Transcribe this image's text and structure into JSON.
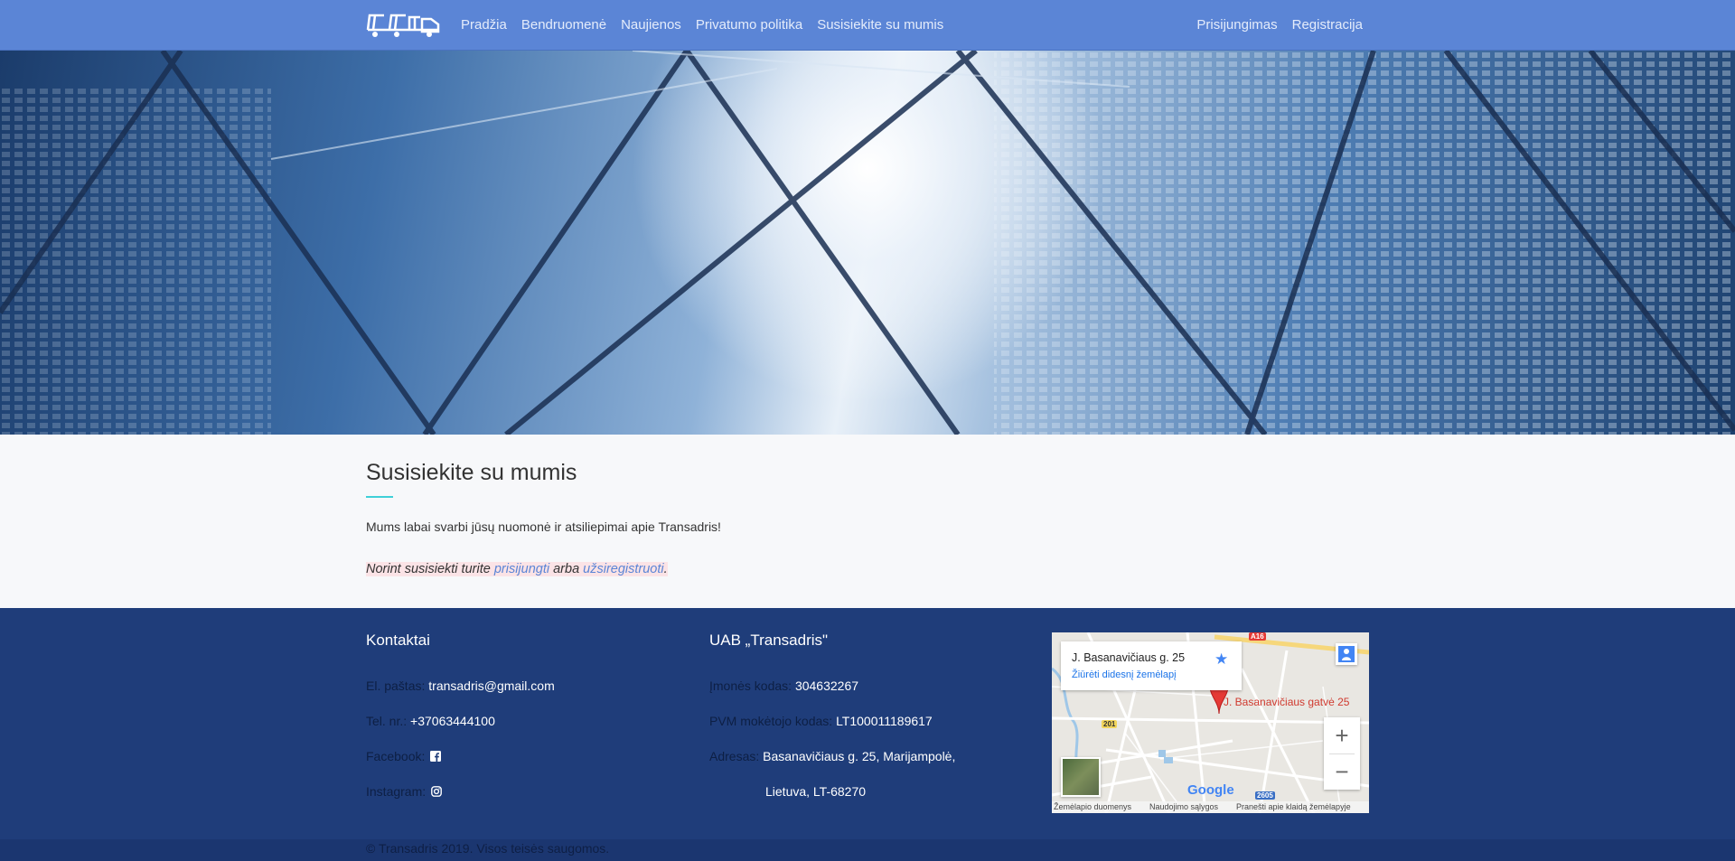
{
  "nav": {
    "logo_alt": "Transadris logo",
    "links": [
      "Pradžia",
      "Bendruomenė",
      "Naujienos",
      "Privatumo politika",
      "Susisiekite su mumis"
    ],
    "right_links": [
      "Prisijungimas",
      "Registracija"
    ]
  },
  "content": {
    "title": "Susisiekite su mumis",
    "intro": "Mums labai svarbi jūsų nuomonė ir atsiliepimai apie Transadris!",
    "notice_prefix": "Norint susisiekti turite ",
    "notice_login": "prisijungti",
    "notice_mid": " arba ",
    "notice_register": "užsiregistruoti",
    "notice_suffix": "."
  },
  "footer": {
    "contacts_title": "Kontaktai",
    "email_label": "El. paštas:",
    "email": "transadris@gmail.com",
    "phone_label": "Tel. nr.:",
    "phone": "+37063444100",
    "facebook_label": "Facebook:",
    "instagram_label": "Instagram:",
    "company_title": "UAB „Transadris\"",
    "code_label": "Įmonės kodas:",
    "code": "304632267",
    "vat_label": "PVM mokėtojo kodas:",
    "vat": "LT100011189617",
    "address_label": "Adresas:",
    "address_line1": "Basanavičiaus g. 25, Marijampolė,",
    "address_line2": "Lietuva, LT-68270",
    "copyright": "© Transadris 2019. Visos teisės saugomos."
  },
  "map": {
    "card_address": "J. Basanavičiaus g. 25",
    "card_link": "Žiūrėti didesnį žemėlapį",
    "pin_label": "J. Basanavičiaus gatvė 25",
    "zoom_in": "+",
    "zoom_out": "−",
    "star": "★",
    "attribution_data": "Žemėlapio duomenys",
    "attribution_terms": "Naudojimo sąlygos",
    "attribution_report": "Pranešti apie klaidą žemėlapyje",
    "road_a16": "A16",
    "road_201": "201",
    "road_2605": "2605",
    "google": "Google",
    "colors": {
      "pin": "#e53935",
      "link": "#1a73e8"
    }
  },
  "colors": {
    "navbar": "#5b85d6",
    "footer": "#1f3d7a",
    "accent": "#3fd0d8",
    "link": "#5b85d6"
  }
}
